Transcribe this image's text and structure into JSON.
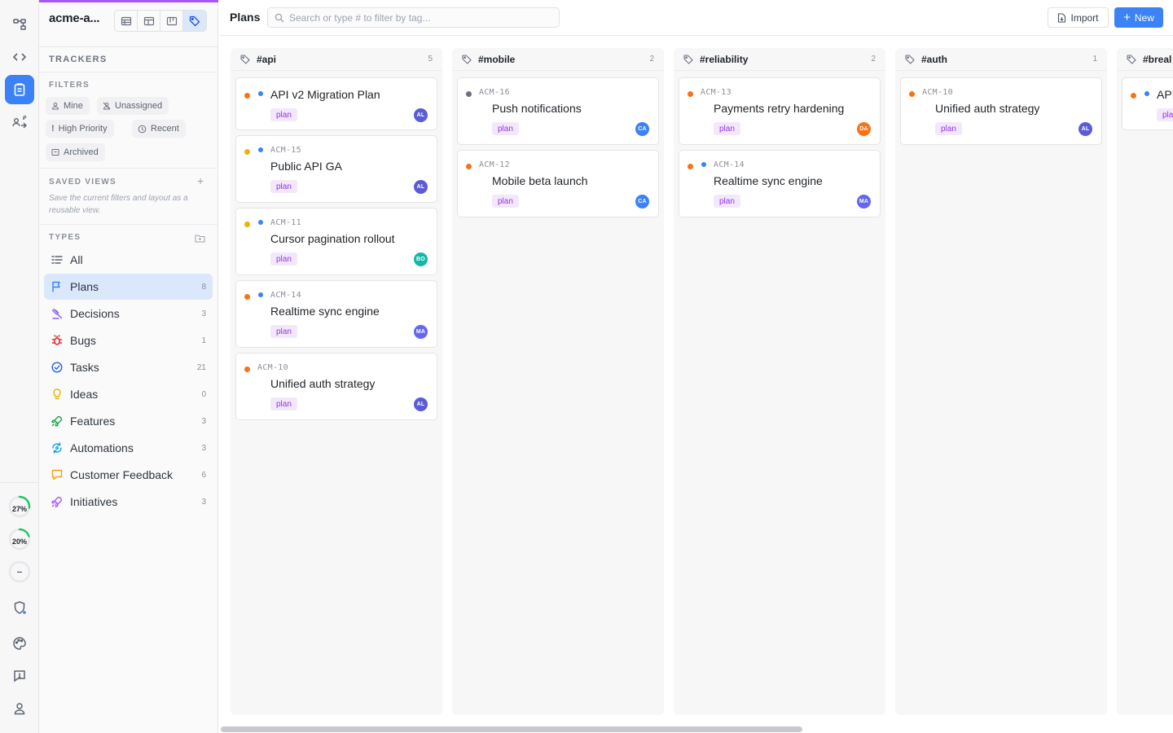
{
  "workspace": {
    "name": "acme-a..."
  },
  "viewmodes": [
    {
      "name": "table-view-icon"
    },
    {
      "name": "split-view-icon"
    },
    {
      "name": "kanban-view-icon"
    },
    {
      "name": "tag-view-icon",
      "active": true
    }
  ],
  "sidebar": {
    "trackers_title": "TRACKERS",
    "filters_title": "FILTERS",
    "filters": [
      "Mine",
      "Unassigned",
      "High Priority",
      "Recent",
      "Archived"
    ],
    "saved_views_title": "SAVED VIEWS",
    "saved_views_hint": "Save the current filters and layout as a reusable view.",
    "types_title": "TYPES",
    "types": [
      {
        "label": "All",
        "count": "",
        "icon": "checklist-icon",
        "color": "#5c6370"
      },
      {
        "label": "Plans",
        "count": "8",
        "icon": "flag-icon",
        "color": "#3b82f6",
        "active": true
      },
      {
        "label": "Decisions",
        "count": "3",
        "icon": "gavel-icon",
        "color": "#8b5cf6"
      },
      {
        "label": "Bugs",
        "count": "1",
        "icon": "bug-icon",
        "color": "#dc2626"
      },
      {
        "label": "Tasks",
        "count": "21",
        "icon": "check-circle-icon",
        "color": "#2563eb"
      },
      {
        "label": "Ideas",
        "count": "0",
        "icon": "lightbulb-icon",
        "color": "#eab308"
      },
      {
        "label": "Features",
        "count": "3",
        "icon": "rocket-icon",
        "color": "#16a34a"
      },
      {
        "label": "Automations",
        "count": "3",
        "icon": "automation-icon",
        "color": "#0ea5e9"
      },
      {
        "label": "Customer Feedback",
        "count": "6",
        "icon": "feedback-icon",
        "color": "#f59e0b"
      },
      {
        "label": "Initiatives",
        "count": "3",
        "icon": "rocket-icon",
        "color": "#a855f7"
      }
    ]
  },
  "rail": {
    "gauges": [
      {
        "label": "27%",
        "value": 0.27
      },
      {
        "label": "20%",
        "value": 0.2
      },
      {
        "label": "--",
        "value": 0
      }
    ]
  },
  "topbar": {
    "title": "Plans",
    "search_placeholder": "Search or type # to filter by tag...",
    "import_label": "Import",
    "new_label": "New"
  },
  "colors": {
    "accent": "#3b82f6",
    "priority_high": "#f97316",
    "priority_medium": "#eab308",
    "priority_none": "#6b7280",
    "status_blue": "#3b82f6"
  },
  "columns": [
    {
      "name": "#api",
      "count": "5",
      "cards": [
        {
          "id": "",
          "title": "API v2 Migration Plan",
          "tag": "plan",
          "avatar": "AL",
          "avatar_color": "#5b5bd6",
          "priority": "#f97316",
          "status": true
        },
        {
          "id": "ACM-15",
          "title": "Public API GA",
          "tag": "plan",
          "avatar": "AL",
          "avatar_color": "#5b5bd6",
          "priority": "#eab308",
          "status": true
        },
        {
          "id": "ACM-11",
          "title": "Cursor pagination rollout",
          "tag": "plan",
          "avatar": "BO",
          "avatar_color": "#14b8a6",
          "priority": "#eab308",
          "status": true
        },
        {
          "id": "ACM-14",
          "title": "Realtime sync engine",
          "tag": "plan",
          "avatar": "MA",
          "avatar_color": "#6366f1",
          "priority": "#f97316",
          "status": true
        },
        {
          "id": "ACM-10",
          "title": "Unified auth strategy",
          "tag": "plan",
          "avatar": "AL",
          "avatar_color": "#5b5bd6",
          "priority": "#f97316",
          "status": false
        }
      ]
    },
    {
      "name": "#mobile",
      "count": "2",
      "cards": [
        {
          "id": "ACM-16",
          "title": "Push notifications",
          "tag": "plan",
          "avatar": "CA",
          "avatar_color": "#3b82f6",
          "priority": "#6b7280",
          "status": false
        },
        {
          "id": "ACM-12",
          "title": "Mobile beta launch",
          "tag": "plan",
          "avatar": "CA",
          "avatar_color": "#3b82f6",
          "priority": "#f97316",
          "status": false
        }
      ]
    },
    {
      "name": "#reliability",
      "count": "2",
      "cards": [
        {
          "id": "ACM-13",
          "title": "Payments retry hardening",
          "tag": "plan",
          "avatar": "DA",
          "avatar_color": "#f97316",
          "priority": "#f97316",
          "status": false
        },
        {
          "id": "ACM-14",
          "title": "Realtime sync engine",
          "tag": "plan",
          "avatar": "MA",
          "avatar_color": "#6366f1",
          "priority": "#f97316",
          "status": true
        }
      ]
    },
    {
      "name": "#auth",
      "count": "1",
      "cards": [
        {
          "id": "ACM-10",
          "title": "Unified auth strategy",
          "tag": "plan",
          "avatar": "AL",
          "avatar_color": "#5b5bd6",
          "priority": "#f97316",
          "status": false
        }
      ]
    },
    {
      "name": "#breal",
      "count": "",
      "cards": [
        {
          "id": "",
          "title": "API",
          "tag": "pla",
          "avatar": "",
          "avatar_color": "#5b5bd6",
          "priority": "#f97316",
          "status": true
        }
      ]
    }
  ]
}
